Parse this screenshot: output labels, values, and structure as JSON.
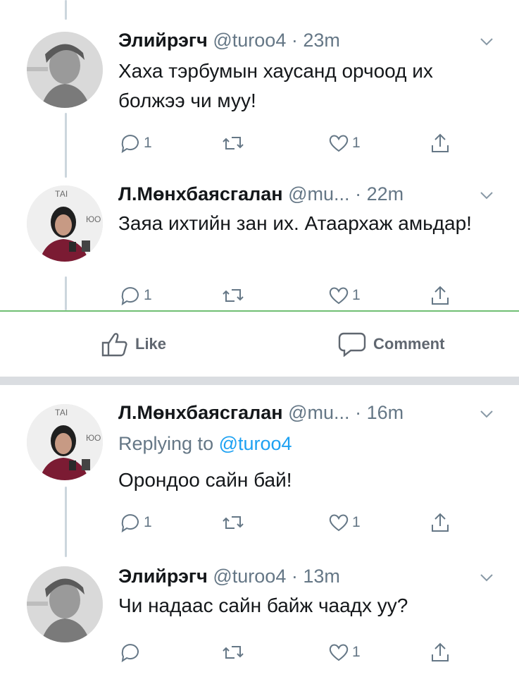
{
  "tweets": [
    {
      "name": "Элийрэгч",
      "handle": "@turoo4",
      "dot": "·",
      "time": "23m",
      "text": "Хаха тэрбумын хаусанд орчоод их болжээ чи муу!",
      "replies": "1",
      "likes": "1"
    },
    {
      "name": "Л.Мөнхбаясгалан",
      "handle": "@mu...",
      "dot": "·",
      "time": "22m",
      "text": "Заяа ихтийн зан их. Атаархаж амьдар!",
      "replies": "1",
      "likes": "1"
    },
    {
      "name": "Л.Мөнхбаясгалан",
      "handle": "@mu...",
      "dot": "·",
      "time": "16m",
      "replying_label": "Replying to",
      "replying_mention": "@turoo4",
      "text": "Орондоо сайн бай!",
      "replies": "1",
      "likes": "1"
    },
    {
      "name": "Элийрэгч",
      "handle": "@turoo4",
      "dot": "·",
      "time": "13m",
      "text": "Чи надаас сайн байж чаадх уу?",
      "replies": "",
      "likes": "1"
    }
  ],
  "facebook_bar": {
    "like_label": "Like",
    "comment_label": "Comment"
  },
  "icons": {
    "reply": "reply-icon",
    "retweet": "retweet-icon",
    "like": "heart-icon",
    "share": "share-icon",
    "more": "chevron-down-icon",
    "fb_like": "thumbs-up-icon",
    "fb_comment": "comment-bubble-icon"
  },
  "colors": {
    "text": "#14171a",
    "secondary": "#657786",
    "mention": "#1da1f2",
    "fb_text": "#606770",
    "divider": "#dadde1",
    "thread_line": "#ccd6dd"
  }
}
